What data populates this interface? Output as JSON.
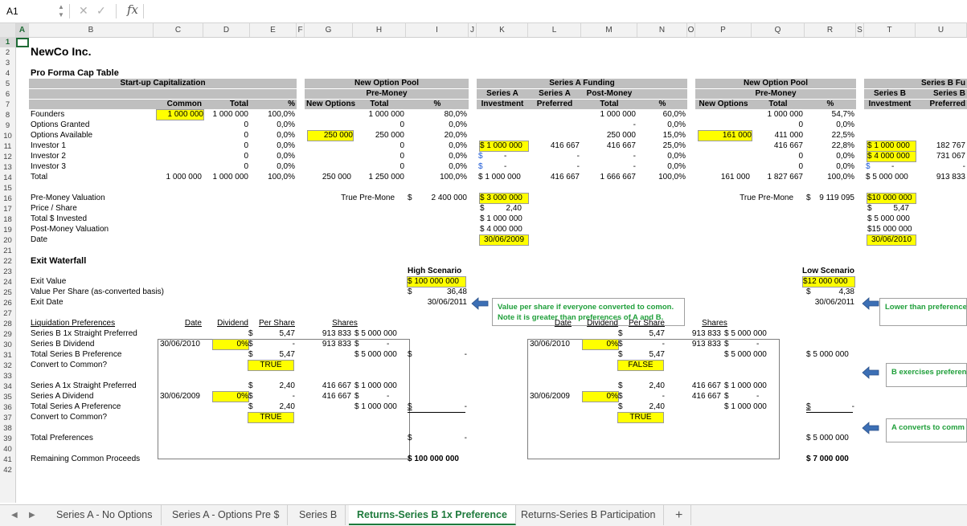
{
  "formula_bar": {
    "cell_ref": "A1",
    "fx_label": "fx",
    "formula": ""
  },
  "columns": [
    "A",
    "B",
    "C",
    "D",
    "E",
    "F",
    "G",
    "H",
    "I",
    "J",
    "K",
    "L",
    "M",
    "N",
    "O",
    "P",
    "Q",
    "R",
    "S",
    "T",
    "U"
  ],
  "rows": [
    "1",
    "2",
    "3",
    "4",
    "5",
    "6",
    "7",
    "8",
    "9",
    "10",
    "11",
    "12",
    "13",
    "14",
    "15",
    "16",
    "17",
    "18",
    "19",
    "20",
    "21",
    "22",
    "23",
    "24",
    "25",
    "26",
    "27",
    "28",
    "29",
    "30",
    "31",
    "32",
    "33",
    "34",
    "35",
    "36",
    "37",
    "38",
    "39",
    "40",
    "41",
    "42"
  ],
  "title": "NewCo Inc.",
  "cap_table": {
    "heading": "Pro Forma Cap Table",
    "startup_header": "Start-up Capitalization",
    "new_option_pool": "New Option Pool",
    "pre_money": "Pre-Money",
    "series_a_funding": "Series A Funding",
    "series_b_funding": "Series B Fu",
    "col_common": "Common",
    "col_total": "Total",
    "col_pct": "%",
    "col_new_options": "New Options",
    "col_series_a": "Series A",
    "col_investment": "Investment",
    "col_preferred": "Preferred",
    "col_post_money": "Post-Money",
    "col_series_b": "Series B",
    "labels": [
      "Founders",
      "Options Granted",
      "Options Available",
      "Investor 1",
      "Investor 2",
      "Investor 3",
      "Total"
    ],
    "common": [
      "1 000 000",
      "",
      "",
      "",
      "",
      "",
      ""
    ],
    "total": [
      "1 000 000",
      "0",
      "0",
      "0",
      "0",
      "0",
      "1 000 000"
    ],
    "pct": [
      "100,0%",
      "0,0%",
      "0,0%",
      "0,0%",
      "0,0%",
      "0,0%",
      "100,0%"
    ],
    "total_common_row14": "1 000 000",
    "new_options": "250 000",
    "new_options_total": "250 000",
    "pre_total": [
      "1 000 000",
      "0",
      "250 000",
      "0",
      "0",
      "0",
      "1 250 000"
    ],
    "pre_pct": [
      "80,0%",
      "0,0%",
      "20,0%",
      "0,0%",
      "0,0%",
      "0,0%",
      "100,0%"
    ],
    "a_invest": [
      "$ 1 000 000",
      "$",
      "$"
    ],
    "a_invest_dash": [
      "-",
      "-"
    ],
    "a_invest_total": "$ 1 000 000",
    "a_pref": [
      "416 667",
      "-",
      "-"
    ],
    "a_pref_total": "416 667",
    "a_post": [
      "1 000 000",
      "-",
      "250 000",
      "416 667",
      "-",
      "-",
      "1 666 667"
    ],
    "a_pct": [
      "60,0%",
      "0,0%",
      "15,0%",
      "25,0%",
      "0,0%",
      "0,0%",
      "100,0%"
    ],
    "b_new_options": "161 000",
    "b_new_options_total": "161 000",
    "b_pre_total": [
      "1 000 000",
      "0",
      "411 000",
      "416 667",
      "0",
      "0",
      "1 827 667"
    ],
    "b_pct": [
      "54,7%",
      "0,0%",
      "22,5%",
      "22,8%",
      "0,0%",
      "0,0%",
      "100,0%"
    ],
    "b_invest": [
      "$ 1 000 000",
      "$ 4 000 000",
      "$"
    ],
    "b_invest_dash": "-",
    "b_invest_total": "$ 5 000 000",
    "b_pref": [
      "182 767",
      "731 067",
      "-"
    ],
    "b_pref_total": "913 833"
  },
  "valuation": {
    "labels": [
      "Pre-Money Valuation",
      "Price / Share",
      "Total $ Invested",
      "Post-Money Valuation",
      "Date"
    ],
    "true_pre_a_label": "True Pre-Mone",
    "true_pre_a_cur": "$",
    "true_pre_a_val": "2 400 000",
    "a_vals": [
      "$ 3 000 000",
      "$",
      "$ 1 000 000",
      "$ 4 000 000",
      "30/06/2009"
    ],
    "a_price": "2,40",
    "true_pre_b_label": "True Pre-Mone",
    "true_pre_b_cur": "$",
    "true_pre_b_val": "9 119 095",
    "b_vals": [
      "$10 000 000",
      "$",
      "$ 5 000 000",
      "$15 000 000",
      "30/06/2010"
    ],
    "b_price": "5,47"
  },
  "waterfall": {
    "heading": "Exit Waterfall",
    "labels": [
      "Exit Value",
      "Value Per Share (as-converted basis)",
      "Exit Date"
    ],
    "high_title": "High Scenario",
    "high_exit": "$ 100 000 000",
    "high_cur": "$",
    "high_vps": "36,48",
    "high_date": "30/06/2011",
    "low_title": "Low Scenario",
    "low_exit": "$12 000 000",
    "low_cur": "$",
    "low_vps": "4,38",
    "low_date": "30/06/2011",
    "note1_l1": "Value per share if everyone converted to comon.",
    "note1_l2": "Note it is greater than preferences of A and B.",
    "note2": "Lower than preference",
    "note3": "B exercises preferen",
    "note4": "A converts to comm",
    "liq_heading": "Liquidation Preferences",
    "liq_labels": [
      "Series B 1x Straight Preferred",
      "Series B Dividend",
      "Total Series B Preference",
      "Convert to Common?",
      "Series A 1x Straight Preferred",
      "Series A Dividend",
      "Total Series A Preference",
      "Convert to Common?"
    ],
    "col_date": "Date",
    "col_dividend": "Dividend",
    "col_per_share": "Per Share",
    "col_shares": "Shares",
    "cur": "$",
    "dash": "-",
    "high": {
      "b_date": "30/06/2010",
      "b_div": "0%",
      "b_ps": "5,47",
      "b_tot_ps": "5,47",
      "b_convert": "TRUE",
      "b_shares": "913 833",
      "b_shares2": "913 833",
      "b_amt": "$ 5 000 000",
      "b_tot_amt": "$ 5 000 000",
      "b_result": "-",
      "a_date": "30/06/2009",
      "a_div": "0%",
      "a_ps": "2,40",
      "a_tot_ps": "2,40",
      "a_convert": "TRUE",
      "a_shares": "416 667",
      "a_shares2": "416 667",
      "a_amt": "$ 1 000 000",
      "a_tot_amt": "$ 1 000 000",
      "a_result": "-"
    },
    "low": {
      "b_date": "30/06/2010",
      "b_div": "0%",
      "b_ps": "5,47",
      "b_tot_ps": "5,47",
      "b_convert": "FALSE",
      "b_shares": "913 833",
      "b_shares2": "913 833",
      "b_amt": "$ 5 000 000",
      "b_tot_amt": "$ 5 000 000",
      "b_result": "$ 5 000 000",
      "a_date": "30/06/2009",
      "a_div": "0%",
      "a_ps": "2,40",
      "a_tot_ps": "2,40",
      "a_convert": "TRUE",
      "a_shares": "416 667",
      "a_shares2": "416 667",
      "a_amt": "$ 1 000 000",
      "a_tot_amt": "$ 1 000 000",
      "a_result": "-"
    },
    "total_pref_label": "Total Preferences",
    "high_total_pref_cur": "$",
    "high_total_pref": "-",
    "low_total_pref": "$ 5 000 000",
    "remaining_label": "Remaining Common Proceeds",
    "high_remaining": "$ 100 000 000",
    "low_remaining": "$ 7 000 000"
  },
  "tabs": [
    "Series A - No Options",
    "Series A - Options Pre $",
    "Series B",
    "Returns-Series B 1x Preference",
    "Returns-Series B Participation"
  ],
  "add_tab": "+",
  "colors": {
    "excel_green": "#1e7a3c",
    "highlight": "#ffff00",
    "header_gray": "#bfbfbf",
    "note_text": "#1f9f3a",
    "arrow_blue": "#3c6fb5"
  }
}
